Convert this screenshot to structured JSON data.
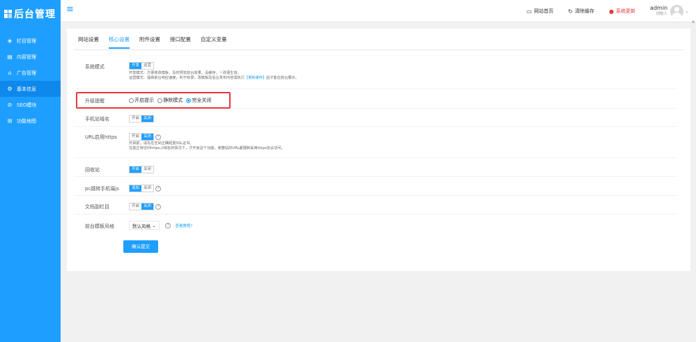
{
  "sidebar": {
    "logo_text": "后台管理",
    "items": [
      {
        "label": "栏目管理",
        "icon": "layers-icon"
      },
      {
        "label": "内容管理",
        "icon": "document-icon"
      },
      {
        "label": "广告管理",
        "icon": "home-icon"
      },
      {
        "label": "基本信息",
        "icon": "gear-icon"
      },
      {
        "label": "SEO模块",
        "icon": "compass-icon"
      },
      {
        "label": "功能地图",
        "icon": "grid-icon"
      }
    ]
  },
  "topbar": {
    "site_home": "网站首页",
    "clear_cache": "清除缓存",
    "system_update": "系统更新",
    "user_name": "admin",
    "user_role": "创始人"
  },
  "tabs": [
    "网站设置",
    "核心设置",
    "附件设置",
    "接口配置",
    "自定义变量"
  ],
  "form": {
    "system_mode": {
      "label": "系统模式",
      "options": [
        "开发",
        "运营"
      ],
      "note1": "开发模式：方便修改模板，及时预览前台效果，没缓存，一改便生效。",
      "note2_prefix": "运营模式：提高前台响应速度，利于收录；改模板及后台发布内容需执行",
      "note2_link": "【更新缓存】",
      "note2_suffix": "后才能在前台展示。"
    },
    "upgrade_reminder": {
      "label": "升级提醒",
      "options": [
        "开启提示",
        "静默模式",
        "完全关闭"
      ]
    },
    "mobile_domain": {
      "label": "手机站域名",
      "options": [
        "开启",
        "关闭"
      ]
    },
    "https": {
      "label": "URL启用https",
      "options": [
        "开启",
        "关闭"
      ],
      "note1": "开启前，请先在空间正确配置SSL证书。",
      "note2": "在能正常访问https://域名的情况下，才开启这个功能，使整站的URL都强制采用https协议访问。"
    },
    "recycle": {
      "label": "回收站",
      "options": [
        "开启",
        "关闭"
      ]
    },
    "pc_jump": {
      "label": "pc跳转手机端js",
      "options": [
        "追加",
        "关闭"
      ]
    },
    "doc_subcolumn": {
      "label": "文档副栏目",
      "options": [
        "开启",
        "关闭"
      ]
    },
    "template_style": {
      "label": "前台模板风格",
      "value": "默认风格",
      "link": "查看教程?"
    },
    "submit_label": "确认提交"
  }
}
